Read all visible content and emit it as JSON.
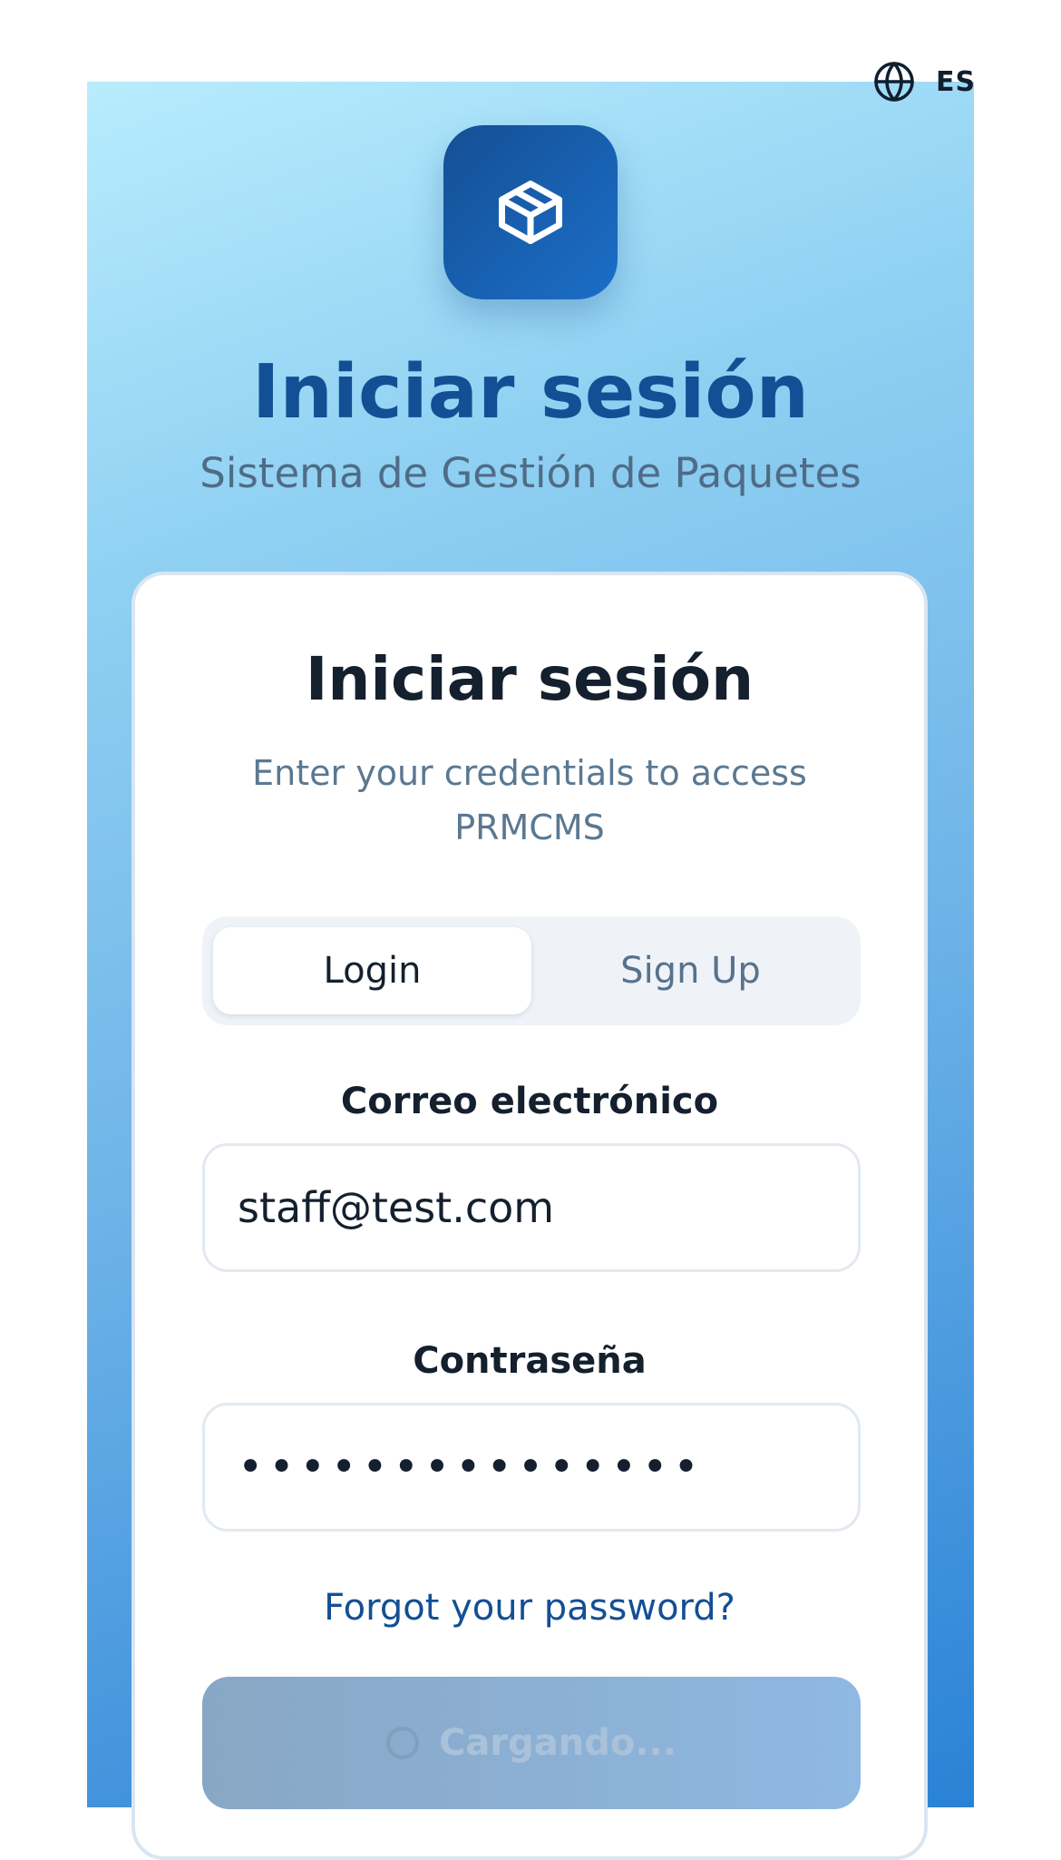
{
  "language": {
    "code": "ES",
    "icon": "globe-icon"
  },
  "branding": {
    "logo_icon": "package-icon",
    "title": "Iniciar sesión",
    "subtitle": "Sistema de Gestión de Paquetes"
  },
  "card": {
    "title": "Iniciar sesión",
    "description": "Enter your credentials to access PRMCMS",
    "tabs": [
      {
        "label": "Login",
        "active": true
      },
      {
        "label": "Sign Up",
        "active": false
      }
    ],
    "email": {
      "label": "Correo electrónico",
      "value": "staff@test.com"
    },
    "password": {
      "label": "Contraseña",
      "value": "•••••••••••••••"
    },
    "forgot_label": "Forgot your password?",
    "submit": {
      "label": "Cargando...",
      "loading": true
    }
  },
  "colors": {
    "primary": "#134f94",
    "gradient_start": "#b8ecfd",
    "gradient_end": "#2a82d6"
  }
}
